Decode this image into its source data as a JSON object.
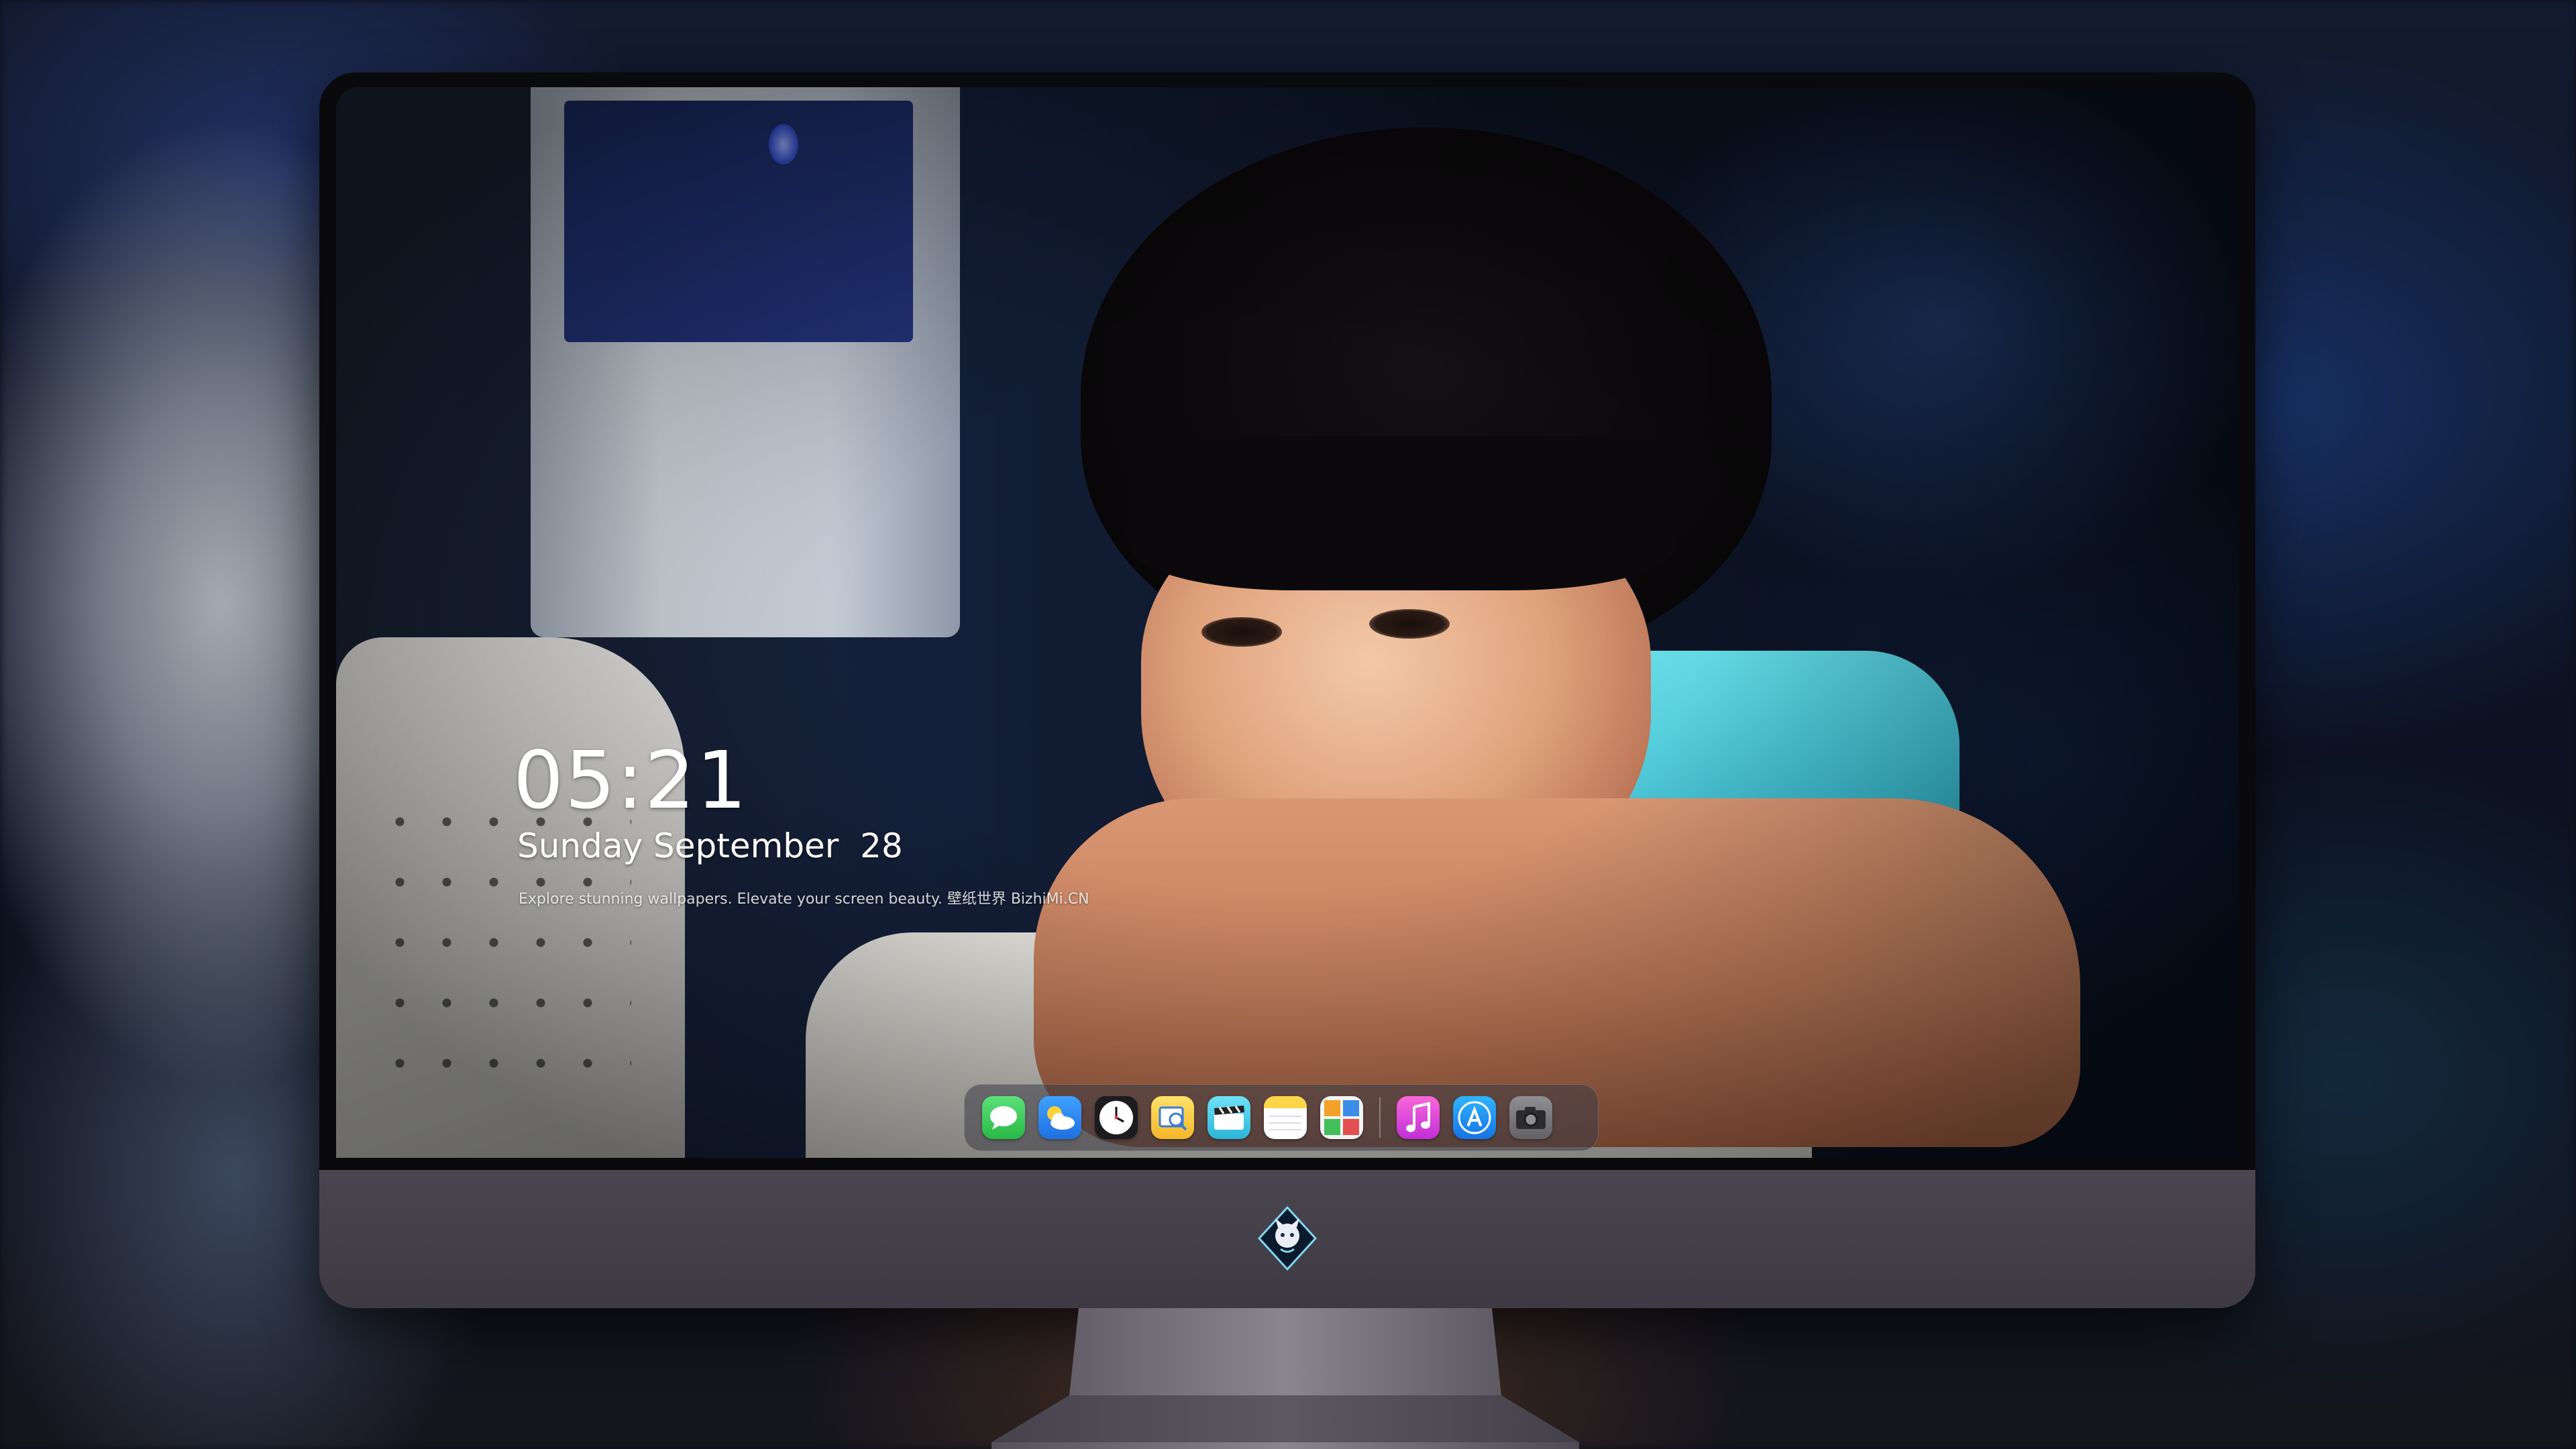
{
  "lock_screen": {
    "time": "05:21",
    "date": "Sunday September  28",
    "tagline": "Explore stunning wallpapers. Elevate your screen beauty. 壁纸世界 BizhiMi.CN"
  },
  "dock": {
    "apps": [
      {
        "name": "Messages",
        "icon": "messages-icon"
      },
      {
        "name": "Weather",
        "icon": "weather-icon"
      },
      {
        "name": "Clock",
        "icon": "clock-icon"
      },
      {
        "name": "Preview",
        "icon": "preview-icon"
      },
      {
        "name": "Clips",
        "icon": "clips-icon"
      },
      {
        "name": "Notes",
        "icon": "notes-icon"
      },
      {
        "name": "Photo Booth",
        "icon": "photo-booth-icon"
      },
      {
        "name": "iTunes",
        "icon": "itunes-icon"
      },
      {
        "name": "App Store",
        "icon": "app-store-icon"
      },
      {
        "name": "Camera",
        "icon": "camera-icon"
      }
    ]
  },
  "colors": {
    "messages": "#34c759",
    "weather": "#2a8cf0",
    "itunes": "#e43ec8",
    "appstore": "#1b8ef2",
    "monitor_chin": "#48444e"
  }
}
